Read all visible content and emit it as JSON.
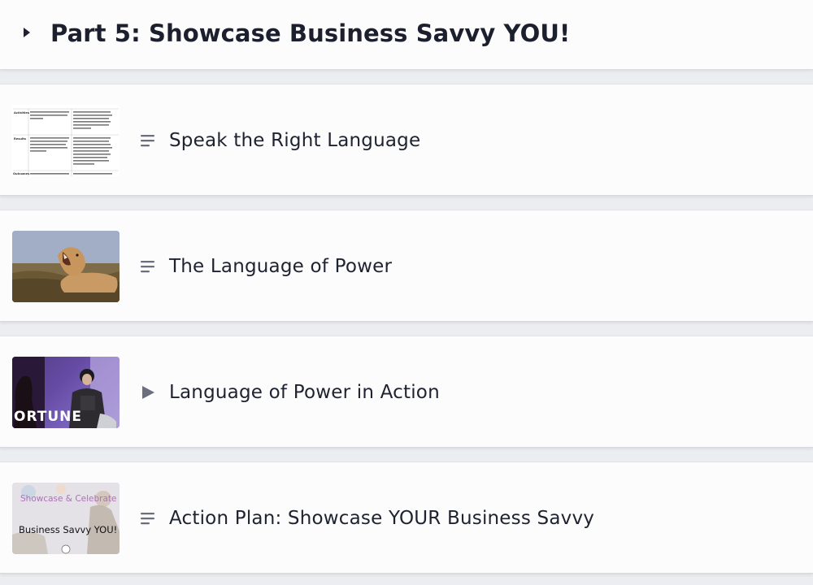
{
  "section": {
    "title": "Part 5: Showcase Business Savvy YOU!",
    "toggle_icon": "caret-right-icon"
  },
  "lessons": [
    {
      "title": "Speak the Right Language",
      "type_icon": "text-lines-icon",
      "thumbnail": "document-table-thumbnail",
      "thumb_text": {
        "row1_label": "Activities",
        "row1_left": "Project planning, routing, system testing, user testing, parallel testing",
        "row1_right": "Creating the blueprints, constructing the addition, training staff, ordering equipment",
        "row2_label": "Results",
        "row2_left": "System is implemented on or ahead of schedule and on or under budget. Performance meets all testing and other thresholds.",
        "row2_right": "ED is opened on schedule and on or under budget. Related training was conducted on schedule, new equipment installed on schedule and performs to standards.",
        "row3_label": "Outcomes",
        "row3_left": "Increased claim payments are",
        "row3_right": "The projected increase in patient"
      }
    },
    {
      "title": "The Language of Power",
      "type_icon": "text-lines-icon",
      "thumbnail": "lioness-roaring-photo"
    },
    {
      "title": "Language of Power in Action",
      "type_icon": "play-icon",
      "thumbnail": "interview-video-still",
      "thumb_text": "ORTUNE"
    },
    {
      "title": "Action Plan: Showcase YOUR Business Savvy",
      "type_icon": "text-lines-icon",
      "thumbnail": "celebration-photo",
      "thumb_text": {
        "top": "Showcase & Celebrate",
        "main": "Business Savvy YOU!"
      }
    }
  ],
  "colors": {
    "page_bg": "#ebedf1",
    "card_bg": "#fcfcfd",
    "icon": "#6b6f7d",
    "text": "#1f2230"
  }
}
